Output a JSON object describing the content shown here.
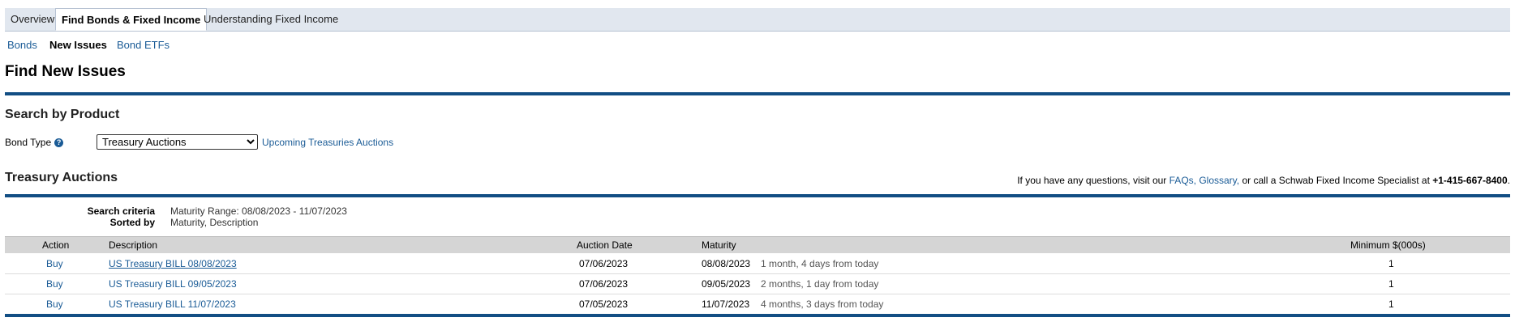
{
  "tabs": [
    {
      "label": "Overview",
      "active": false
    },
    {
      "label": "Find Bonds & Fixed Income",
      "active": true
    },
    {
      "label": "Understanding Fixed Income",
      "active": false
    }
  ],
  "subnav": {
    "bonds": "Bonds",
    "new_issues": "New Issues",
    "bond_etfs": "Bond ETFs"
  },
  "page_title": "Find New Issues",
  "search": {
    "heading": "Search by Product",
    "bond_type_label": "Bond Type",
    "help_icon": "?",
    "selected": "Treasury Auctions",
    "upcoming_link": "Upcoming Treasuries Auctions"
  },
  "results": {
    "heading": "Treasury Auctions",
    "contact_pre": "If you have any questions, visit our ",
    "faqs_link": "FAQs,",
    "glossary_link": "Glossary,",
    "contact_mid": " or call a Schwab Fixed Income Specialist at ",
    "phone": "+1-415-667-8400",
    "contact_end": ".",
    "criteria_label": "Search criteria",
    "criteria_value": "Maturity Range: 08/08/2023 - 11/07/2023",
    "sorted_label": "Sorted by",
    "sorted_value": "Maturity, Description"
  },
  "table": {
    "headers": {
      "action": "Action",
      "description": "Description",
      "auction_date": "Auction Date",
      "maturity": "Maturity",
      "minimum": "Minimum $(000s)"
    },
    "rows": [
      {
        "action": "Buy",
        "description": "US Treasury BILL 08/08/2023",
        "auction_date": "07/06/2023",
        "maturity": "08/08/2023",
        "relative": "1 month, 4 days from today",
        "minimum": "1"
      },
      {
        "action": "Buy",
        "description": "US Treasury BILL 09/05/2023",
        "auction_date": "07/06/2023",
        "maturity": "09/05/2023",
        "relative": "2 months, 1 day from today",
        "minimum": "1"
      },
      {
        "action": "Buy",
        "description": "US Treasury BILL 11/07/2023",
        "auction_date": "07/05/2023",
        "maturity": "11/07/2023",
        "relative": "4 months, 3 days from today",
        "minimum": "1"
      }
    ]
  },
  "colors": {
    "accent": "#1a5b96",
    "rule": "#124e84",
    "tab_bg": "#e1e7ef",
    "header_bg": "#d5d5d5"
  }
}
